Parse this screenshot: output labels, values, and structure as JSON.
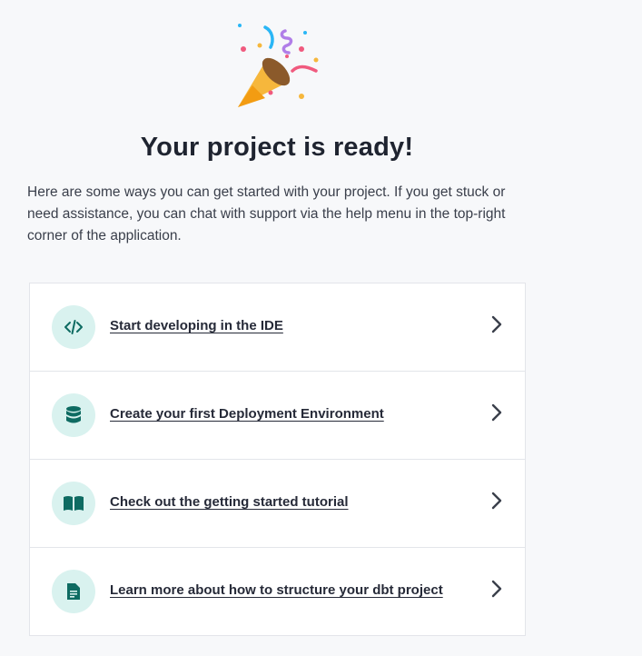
{
  "header": {
    "title": "Your project is ready!",
    "intro": "Here are some ways you can get started with your project. If you get stuck or need assistance, you can chat with support via the help menu in the top-right corner of the application."
  },
  "items": [
    {
      "label": "Start developing in the IDE",
      "icon": "code-icon"
    },
    {
      "label": "Create your first Deployment Environment",
      "icon": "database-icon"
    },
    {
      "label": "Check out the getting started tutorial",
      "icon": "book-icon"
    },
    {
      "label": "Learn more about how to structure your dbt project",
      "icon": "document-icon"
    }
  ],
  "colors": {
    "background": "#f7f8fa",
    "icon_circle": "#d9f2ef",
    "icon_glyph": "#0e6b62"
  }
}
